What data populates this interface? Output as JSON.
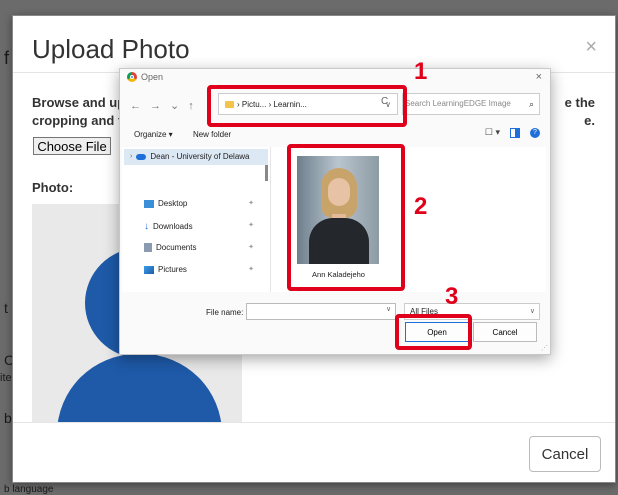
{
  "background": {
    "fragments": [
      "f",
      "t",
      "C",
      "ite",
      "b",
      "b language"
    ]
  },
  "modal": {
    "title": "Upload Photo",
    "close": "×",
    "instruction_left_1": "Browse and up",
    "instruction_left_2": "cropping and f",
    "instruction_right_1": "e the",
    "instruction_right_2": "e.",
    "choose_file": "Choose File",
    "photo_label": "Photo:",
    "cancel": "Cancel"
  },
  "dialog": {
    "title": "Open",
    "close": "×",
    "address": {
      "crumbs": "›  Pictu...  ›  Learnin...",
      "dropdown": "∨",
      "refresh": "C"
    },
    "search_placeholder": "Search LearningEDGE Image",
    "toolbar": {
      "organize": "Organize ▾",
      "new_folder": "New folder"
    },
    "nav": {
      "cloud": "Dean - University of Delawa",
      "items": [
        "Desktop",
        "Downloads",
        "Documents",
        "Pictures"
      ]
    },
    "file": {
      "name": "Ann Kaladejeho"
    },
    "filename_label": "File name:",
    "filetype": "All Files",
    "open": "Open",
    "cancel": "Cancel"
  },
  "annotations": {
    "step1": "1",
    "step2": "2",
    "step3": "3"
  },
  "colors": {
    "highlight": "#e0001b",
    "avatar": "#1e5aa8",
    "accent": "#1e6fd9"
  }
}
